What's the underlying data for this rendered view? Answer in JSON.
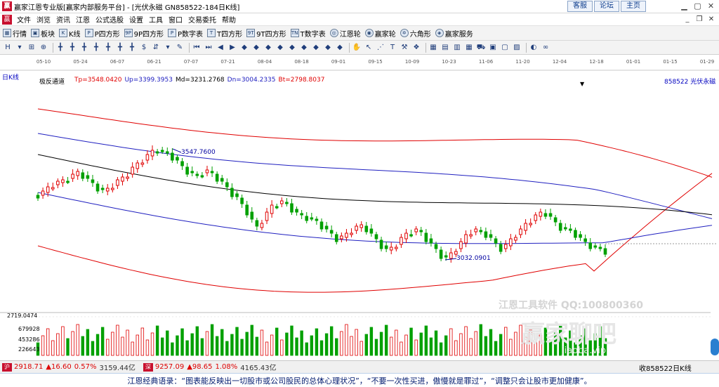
{
  "titlebar": {
    "logo": "赢",
    "title": "赢家江恩专业版[赢家内部服务平台] - [光伏永磁   GN858522-184日K线]",
    "links": [
      "客服",
      "论坛",
      "主页"
    ],
    "min_icon": "minimize-icon",
    "max_icon": "maximize-icon",
    "close_icon": "close-icon"
  },
  "menubar": {
    "logo": "赢",
    "items": [
      "文件",
      "浏览",
      "资讯",
      "江恩",
      "公式选股",
      "设置",
      "工具",
      "窗口",
      "交易委托",
      "帮助"
    ]
  },
  "toolbar1": {
    "items": [
      {
        "icon": "grid-icon",
        "glyph": "▦",
        "label": "行情"
      },
      {
        "icon": "blocks-icon",
        "glyph": "▣",
        "label": "板块"
      },
      {
        "icon": "kline-icon",
        "glyph": "K",
        "label": "K线"
      },
      {
        "icon": "p-square-icon",
        "glyph": "P",
        "label": "P四方形"
      },
      {
        "icon": "9p-square-icon",
        "glyph": "9P",
        "label": "9P四方形"
      },
      {
        "icon": "p-number-icon",
        "glyph": "P",
        "label": "P数字表"
      },
      {
        "icon": "t-square-icon",
        "glyph": "T",
        "label": "T四方形"
      },
      {
        "icon": "9t-square-icon",
        "glyph": "9T",
        "label": "9T四方形"
      },
      {
        "icon": "t-number-icon",
        "glyph": "TN",
        "label": "T数字表"
      },
      {
        "icon": "gann-wheel-icon",
        "glyph": "◎",
        "label": "江恩轮"
      },
      {
        "icon": "winner-wheel-icon",
        "glyph": "◉",
        "label": "赢家轮"
      },
      {
        "icon": "hexagon-icon",
        "glyph": "✡",
        "label": "六角形"
      },
      {
        "icon": "service-icon",
        "glyph": "◈",
        "label": "赢家服务"
      }
    ]
  },
  "toolbar2": {
    "buttons": [
      {
        "icon": "period-icon",
        "glyph": "H"
      },
      {
        "icon": "dropdown-icon",
        "glyph": "▾"
      },
      {
        "icon": "chart-type-icon",
        "glyph": "⊞"
      },
      {
        "icon": "zoom-icon",
        "glyph": "⊕"
      },
      {
        "icon": "candle-icon",
        "glyph": "╋"
      },
      {
        "icon": "candle-2-icon",
        "glyph": "╋"
      },
      {
        "icon": "candle-3-icon",
        "glyph": "╋"
      },
      {
        "icon": "candle-4-icon",
        "glyph": "╋"
      },
      {
        "icon": "candle-5-icon",
        "glyph": "╋"
      },
      {
        "icon": "candle-6-icon",
        "glyph": "╋"
      },
      {
        "icon": "candle-7-icon",
        "glyph": "╋"
      },
      {
        "icon": "dollar-icon",
        "glyph": "$"
      },
      {
        "icon": "arrow-icon",
        "glyph": "⇵"
      },
      {
        "icon": "dropdown-2-icon",
        "glyph": "▾"
      },
      {
        "icon": "draw-icon",
        "glyph": "✎"
      },
      {
        "icon": "first-icon",
        "glyph": "⏮"
      },
      {
        "icon": "next-icon",
        "glyph": "⏭"
      },
      {
        "icon": "prev-icon",
        "glyph": "◀"
      },
      {
        "icon": "play-icon",
        "glyph": "▶"
      },
      {
        "icon": "diamond-icon",
        "glyph": "◆"
      },
      {
        "icon": "diamond-2-icon",
        "glyph": "◆"
      },
      {
        "icon": "diamond-3-icon",
        "glyph": "◆"
      },
      {
        "icon": "diamond-4-icon",
        "glyph": "◆"
      },
      {
        "icon": "diamond-5-icon",
        "glyph": "◆"
      },
      {
        "icon": "diamond-6-icon",
        "glyph": "◆"
      },
      {
        "icon": "diamond-7-icon",
        "glyph": "◆"
      },
      {
        "icon": "diamond-8-icon",
        "glyph": "◆"
      },
      {
        "icon": "diamond-9-icon",
        "glyph": "◆"
      },
      {
        "icon": "hand-icon",
        "glyph": "✋"
      },
      {
        "icon": "cursor-icon",
        "glyph": "↖"
      },
      {
        "icon": "trend-icon",
        "glyph": "⋰"
      },
      {
        "icon": "text-icon",
        "glyph": "T"
      },
      {
        "icon": "tool-icon",
        "glyph": "⚒"
      },
      {
        "icon": "shape-icon",
        "glyph": "❖"
      },
      {
        "icon": "calendar-icon",
        "glyph": "▦"
      },
      {
        "icon": "window-icon",
        "glyph": "▤"
      },
      {
        "icon": "window-2-icon",
        "glyph": "▥"
      },
      {
        "icon": "grid-2-icon",
        "glyph": "▦"
      },
      {
        "icon": "car-icon",
        "glyph": "⛟"
      },
      {
        "icon": "layout-icon",
        "glyph": "▣"
      },
      {
        "icon": "layout-2-icon",
        "glyph": "▢"
      },
      {
        "icon": "layout-3-icon",
        "glyph": "▨"
      },
      {
        "icon": "color-icon",
        "glyph": "◐"
      },
      {
        "icon": "infinity-icon",
        "glyph": "∞"
      }
    ]
  },
  "chart": {
    "period": "日K线",
    "indicator": {
      "name": "极反通道",
      "tp": "Tp=3548.0420",
      "up": "Up=3399.3953",
      "md": "Md=3231.2768",
      "dn": "Dn=3004.2335",
      "bt": "Bt=2798.8037"
    },
    "code_name": "858522  光伏永磁",
    "dates": [
      "05-10",
      "05-24",
      "06-07",
      "06-21",
      "07-07",
      "07-21",
      "08-04",
      "08-18",
      "09-01",
      "09-15",
      "10-09",
      "10-23",
      "11-06",
      "11-20",
      "12-04",
      "12-18",
      "01-01",
      "01-15",
      "01-29"
    ],
    "high_label": "3547.7600",
    "low_label": "3032.0901",
    "watermark_top": "江恩工具软件  QQ:100800360",
    "watermark_main": "赢家聊吧",
    "watermark_url": "jiaoba.vip",
    "vol_axis_top": "2719.0474",
    "vol_ticks": [
      "679928",
      "453286",
      "226643"
    ],
    "colors": {
      "up": "#e00000",
      "down": "#00a000",
      "band_red": "#e00000",
      "band_blue": "#2020c0",
      "mid": "#000000"
    }
  },
  "chart_data": {
    "type": "candlestick",
    "title": "光伏永磁 GN858522 日K线",
    "indicator": "极反通道",
    "x_ticks": [
      "05-10",
      "05-24",
      "06-07",
      "06-21",
      "07-07",
      "07-21",
      "08-04",
      "08-18",
      "09-01",
      "09-15",
      "10-09",
      "10-23",
      "11-06",
      "11-20",
      "12-04",
      "12-18",
      "01-01",
      "01-15",
      "01-29"
    ],
    "indicator_last": {
      "Tp": 3548.042,
      "Up": 3399.3953,
      "Md": 3231.2768,
      "Dn": 3004.2335,
      "Bt": 2798.8037
    },
    "annotations": [
      {
        "label": "3547.7600",
        "kind": "high"
      },
      {
        "label": "3032.0901",
        "kind": "low"
      }
    ],
    "volume_ticks": [
      679928,
      453286,
      226643
    ]
  },
  "statusbar": {
    "item1_icon": "沪",
    "item1_price": "2918.71",
    "item1_change": "▲16.60",
    "item1_pct": "0.57%",
    "item1_amount": "3159.44亿",
    "item2_icon": "深",
    "item2_price": "9257.09",
    "item2_change": "▲98.65",
    "item2_pct": "1.08%",
    "item2_amount": "4165.43亿",
    "right": "收858522日K线"
  },
  "quote": "江恩经典语录：“图表能反映出一切股市或公司股民的总体心理状况”，“不要一次性买进，傲慢就是罪过”，“调整只会让股市更加健康”。"
}
